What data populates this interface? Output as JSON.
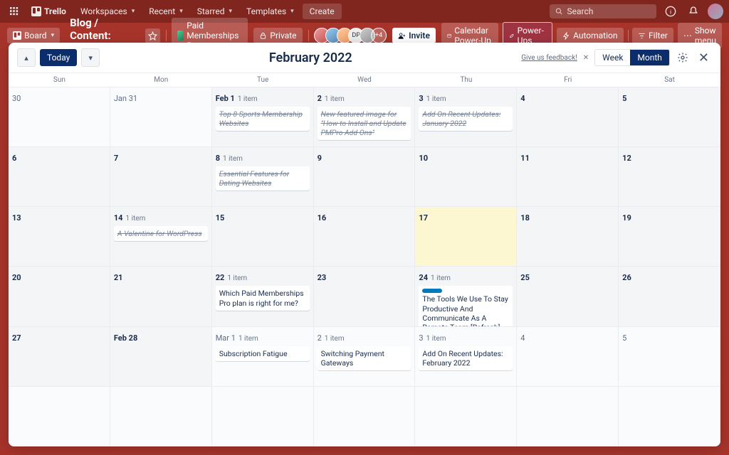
{
  "topnav": {
    "brand": "Trello",
    "menu": [
      "Workspaces",
      "Recent",
      "Starred",
      "Templates"
    ],
    "create": "Create",
    "search_placeholder": "Search"
  },
  "boardbar": {
    "board_btn": "Board",
    "title": "Blog / Content: PMPro",
    "workspace": "Paid Memberships Pro",
    "visibility": "Private",
    "invite": "Invite",
    "more_members": "+4",
    "calendar_powerup": "Calendar Power-Up",
    "powerups": "Power-Ups",
    "automation": "Automation",
    "filter": "Filter",
    "show_menu": "Show menu"
  },
  "calendar": {
    "today": "Today",
    "title": "February 2022",
    "feedback": "Give us feedback!",
    "week": "Week",
    "month": "Month",
    "dayheaders": [
      "Sun",
      "Mon",
      "Tue",
      "Wed",
      "Thu",
      "Fri",
      "Sat"
    ]
  },
  "cells": [
    {
      "label": "30",
      "out": true
    },
    {
      "label": "Jan 31",
      "out": true
    },
    {
      "label": "Feb 1",
      "bold": true,
      "count": "1 item",
      "cards": [
        {
          "text": "Top 8 Sports Membership Websites",
          "done": true
        }
      ]
    },
    {
      "label": "2",
      "bold": true,
      "count": "1 item",
      "cards": [
        {
          "text": "New featured image for \"How to Install and Update PMPro Add Ons\"",
          "done": true
        }
      ]
    },
    {
      "label": "3",
      "bold": true,
      "count": "1 item",
      "cards": [
        {
          "text": "Add On Recent Updates: January 2022",
          "done": true
        }
      ]
    },
    {
      "label": "4",
      "bold": true
    },
    {
      "label": "5",
      "bold": true
    },
    {
      "label": "6",
      "bold": true
    },
    {
      "label": "7",
      "bold": true
    },
    {
      "label": "8",
      "bold": true,
      "count": "1 item",
      "cards": [
        {
          "text": "Essential Features for Dating Websites",
          "done": true
        }
      ]
    },
    {
      "label": "9",
      "bold": true
    },
    {
      "label": "10",
      "bold": true
    },
    {
      "label": "11",
      "bold": true
    },
    {
      "label": "12",
      "bold": true
    },
    {
      "label": "13",
      "bold": true
    },
    {
      "label": "14",
      "bold": true,
      "count": "1 item",
      "cards": [
        {
          "text": "A Valentine for WordPress",
          "done": true
        }
      ]
    },
    {
      "label": "15",
      "bold": true
    },
    {
      "label": "16",
      "bold": true
    },
    {
      "label": "17",
      "bold": true,
      "today": true
    },
    {
      "label": "18",
      "bold": true
    },
    {
      "label": "19",
      "bold": true
    },
    {
      "label": "20",
      "bold": true
    },
    {
      "label": "21",
      "bold": true
    },
    {
      "label": "22",
      "bold": true,
      "count": "1 item",
      "cards": [
        {
          "text": "Which Paid Memberships Pro plan is right for me?"
        }
      ]
    },
    {
      "label": "23",
      "bold": true
    },
    {
      "label": "24",
      "bold": true,
      "count": "1 item",
      "cards": [
        {
          "text": "The Tools We Use To Stay Productive And Communicate As A Remote Team [Refresh]",
          "label": true
        }
      ]
    },
    {
      "label": "25",
      "bold": true
    },
    {
      "label": "26",
      "bold": true
    },
    {
      "label": "27",
      "bold": true
    },
    {
      "label": "Feb 28",
      "bold": true
    },
    {
      "label": "Mar 1",
      "out": true,
      "count": "1 item",
      "cards": [
        {
          "text": "Subscription Fatigue"
        }
      ]
    },
    {
      "label": "2",
      "out": true,
      "count": "1 item",
      "cards": [
        {
          "text": "Switching Payment Gateways"
        }
      ]
    },
    {
      "label": "3",
      "out": true,
      "count": "1 item",
      "cards": [
        {
          "text": "Add On Recent Updates: February 2022"
        }
      ]
    },
    {
      "label": "4",
      "out": true
    },
    {
      "label": "5",
      "out": true
    },
    {
      "label": "",
      "out": true
    },
    {
      "label": "",
      "out": true
    },
    {
      "label": "",
      "out": true
    },
    {
      "label": "",
      "out": true
    },
    {
      "label": "",
      "out": true
    },
    {
      "label": "",
      "out": true
    },
    {
      "label": "",
      "out": true
    }
  ]
}
